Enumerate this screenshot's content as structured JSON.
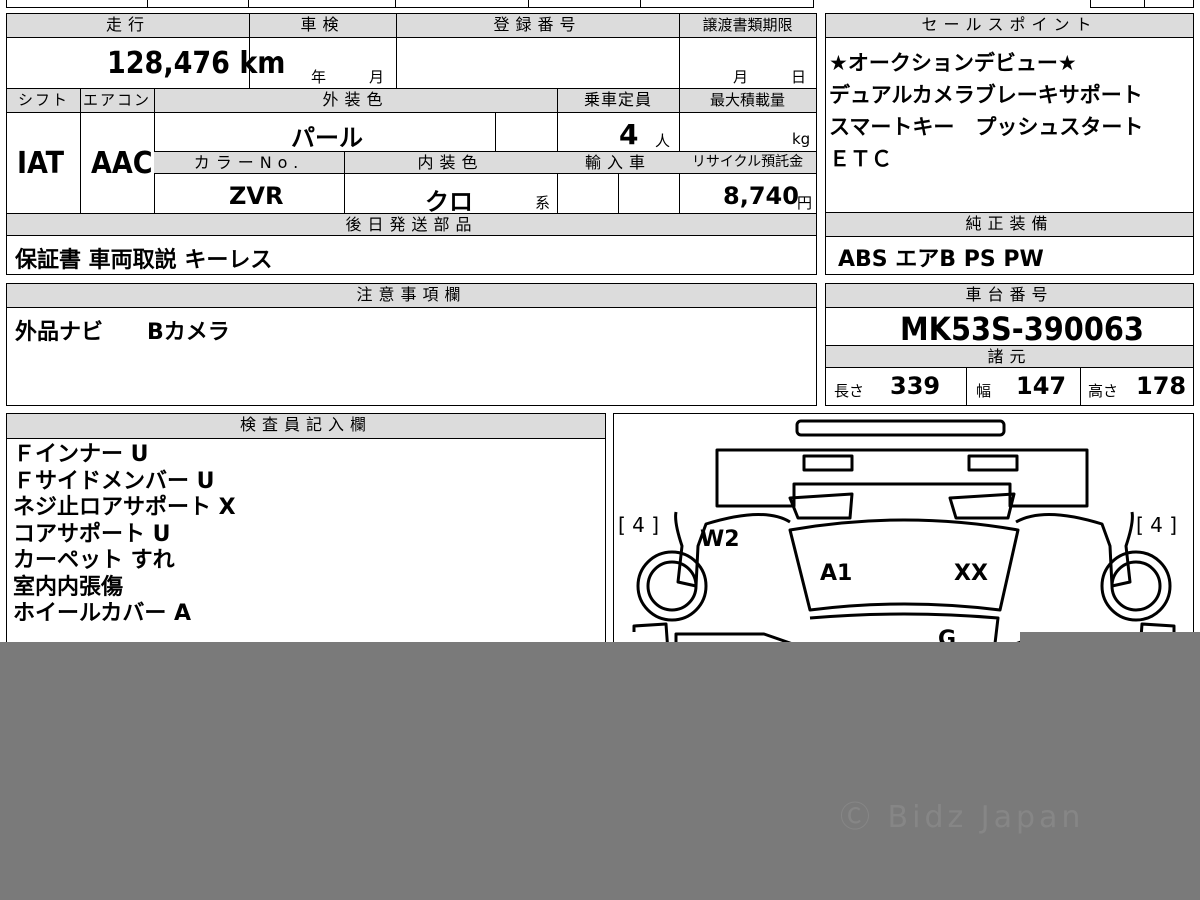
{
  "mileage": {
    "label": "走行",
    "value": "128,476 km"
  },
  "inspection": {
    "label": "車検",
    "year_unit": "年",
    "month_unit": "月"
  },
  "registration": {
    "label": "登録番号",
    "value": ""
  },
  "transfer_deadline": {
    "label": "譲渡書類期限",
    "month_unit": "月",
    "day_unit": "日"
  },
  "selling_points": {
    "label": "セールスポイント",
    "lines": [
      "★オークションデビュー★",
      "デュアルカメラブレーキサポート",
      "スマートキー　プッシュスタート",
      "ＥＴＣ"
    ]
  },
  "shift": {
    "label": "シフト",
    "value": "IAT"
  },
  "aircon": {
    "label": "エアコン",
    "value": "AAC"
  },
  "exterior_color": {
    "label": "外装色",
    "value": "パール"
  },
  "capacity": {
    "label": "乗車定員",
    "value": "4",
    "unit": "人"
  },
  "max_load": {
    "label": "最大積載量",
    "unit": "kg"
  },
  "color_no": {
    "label": "カラーNo.",
    "value": "ZVR"
  },
  "interior_color": {
    "label": "内装色",
    "value": "クロ",
    "suffix": "系"
  },
  "import": {
    "label": "輸入車"
  },
  "recycle": {
    "label": "リサイクル預託金",
    "value": "8,740",
    "unit": "円"
  },
  "later_items": {
    "label": "後日発送部品",
    "value": "保証書 車両取説 キーレス"
  },
  "standard_equipment": {
    "label": "純正装備",
    "value": "ABS エアB PS PW"
  },
  "notes": {
    "label": "注意事項欄",
    "value": "外品ナビ　　Bカメラ"
  },
  "chassis": {
    "label": "車台番号",
    "value": "MK53S-390063"
  },
  "specs": {
    "label": "諸元",
    "length_label": "長さ",
    "length": "339",
    "width_label": "幅",
    "width": "147",
    "height_label": "高さ",
    "height": "178"
  },
  "inspector": {
    "label": "検査員記入欄",
    "lines": [
      "Ｆインナー U",
      "Ｆサイドメンバー U",
      "ネジ止ロアサポート X",
      "コアサポート U",
      "カーペット すれ",
      "室内内張傷",
      "ホイールカバー A"
    ]
  },
  "diagram": {
    "tire_left": "[ 4 ]",
    "tire_right": "[ 4 ]",
    "marks": [
      "W2",
      "A1",
      "XX",
      "G"
    ]
  },
  "watermark": "Ⓒ Bidz Japan"
}
